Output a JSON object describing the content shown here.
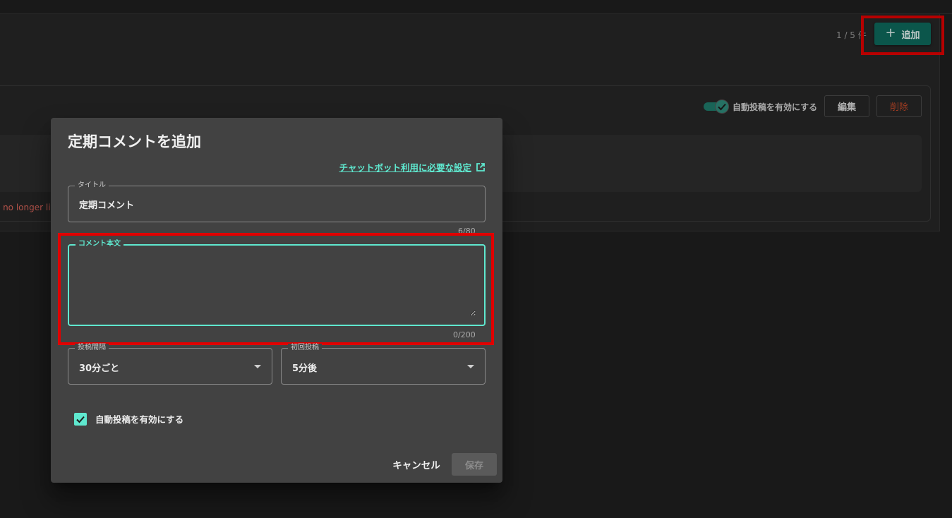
{
  "header": {
    "count_text": "1 / 5 件",
    "add_button_label": "追加"
  },
  "item": {
    "auto_post_label": "自動投稿を有効にする",
    "edit_label": "編集",
    "delete_label": "削除",
    "warning_text": "s no longer liv"
  },
  "dialog": {
    "title": "定期コメントを追加",
    "settings_link": "チャットボット利用に必要な設定",
    "title_field": {
      "label": "タイトル",
      "value": "定期コメント",
      "counter": "6/80"
    },
    "body_field": {
      "label": "コメント本文",
      "value": "",
      "counter": "0/200"
    },
    "interval_select": {
      "label": "投稿間隔",
      "value": "30分ごと"
    },
    "first_post_select": {
      "label": "初回投稿",
      "value": "5分後"
    },
    "auto_post_checkbox": {
      "label": "自動投稿を有効にする",
      "checked": true
    },
    "cancel_label": "キャンセル",
    "save_label": "保存"
  },
  "colors": {
    "accent": "#5fe8cf",
    "primary_button": "#0e6a5c",
    "danger": "#c0492a",
    "highlight": "#e00000"
  },
  "icons": {
    "add": "plus-icon",
    "external_link": "external-link-icon",
    "select_caret": "caret-down-icon",
    "check": "check-icon"
  }
}
